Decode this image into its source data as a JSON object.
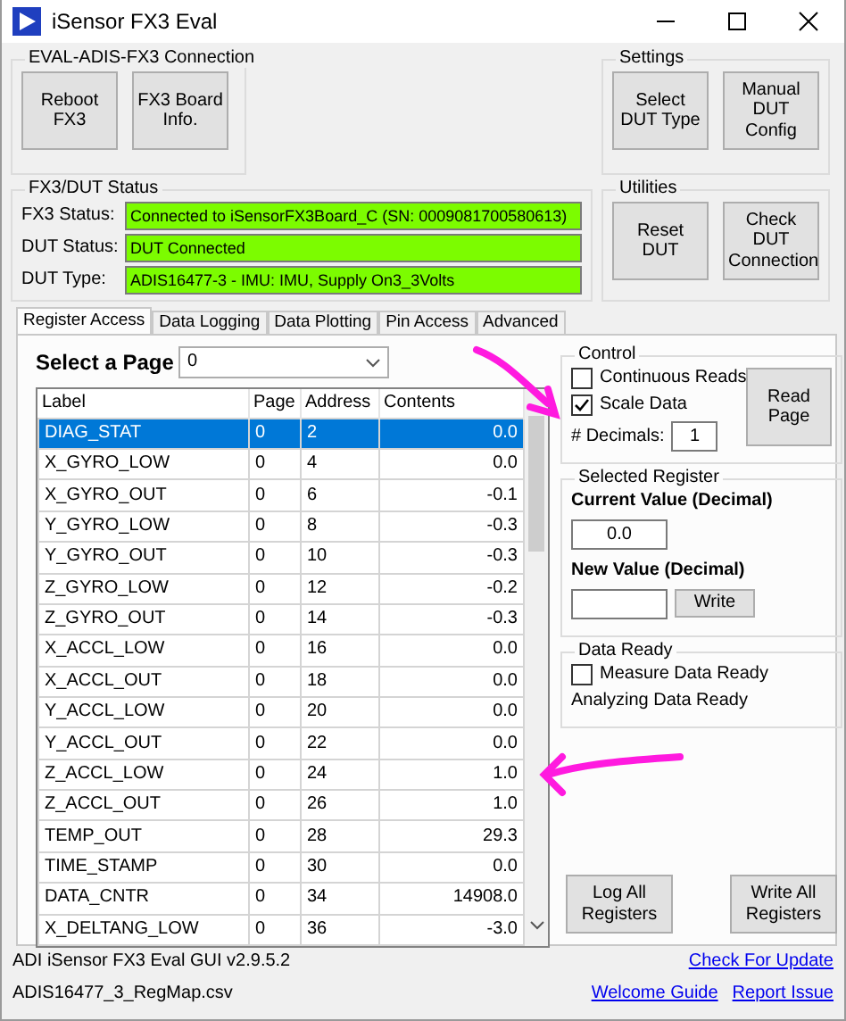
{
  "window": {
    "title": "iSensor FX3 Eval"
  },
  "connection": {
    "title": "EVAL-ADIS-FX3 Connection",
    "buttons": [
      "Reboot FX3",
      "FX3 Board Info."
    ]
  },
  "settings": {
    "title": "Settings",
    "buttons": [
      "Select DUT Type",
      "Manual DUT Config"
    ]
  },
  "status": {
    "title": "FX3/DUT Status",
    "fields": [
      {
        "label": "FX3 Status:",
        "value": "Connected to iSensorFX3Board_C (SN: 0009081700580613)"
      },
      {
        "label": "DUT Status:",
        "value": "DUT Connected"
      },
      {
        "label": "DUT Type:",
        "value": "ADIS16477-3 - IMU: IMU, Supply On3_3Volts"
      }
    ]
  },
  "utilities": {
    "title": "Utilities",
    "buttons": [
      "Reset DUT",
      "Check DUT Connection"
    ]
  },
  "tabs": [
    {
      "label": "Register Access",
      "selected": true
    },
    {
      "label": "Data Logging",
      "selected": false
    },
    {
      "label": "Data Plotting",
      "selected": false
    },
    {
      "label": "Pin Access",
      "selected": false
    },
    {
      "label": "Advanced",
      "selected": false
    }
  ],
  "page_select": {
    "label": "Select a Page",
    "value": "0"
  },
  "table": {
    "columns": [
      "Label",
      "Page",
      "Address",
      "Contents"
    ],
    "rows": [
      {
        "cells": [
          "DIAG_STAT",
          "0",
          "2",
          "0.0"
        ],
        "selected": true
      },
      {
        "cells": [
          "X_GYRO_LOW",
          "0",
          "4",
          "0.0"
        ],
        "selected": false
      },
      {
        "cells": [
          "X_GYRO_OUT",
          "0",
          "6",
          "-0.1"
        ],
        "selected": false
      },
      {
        "cells": [
          "Y_GYRO_LOW",
          "0",
          "8",
          "-0.3"
        ],
        "selected": false
      },
      {
        "cells": [
          "Y_GYRO_OUT",
          "0",
          "10",
          "-0.3"
        ],
        "selected": false
      },
      {
        "cells": [
          "Z_GYRO_LOW",
          "0",
          "12",
          "-0.2"
        ],
        "selected": false
      },
      {
        "cells": [
          "Z_GYRO_OUT",
          "0",
          "14",
          "-0.3"
        ],
        "selected": false
      },
      {
        "cells": [
          "X_ACCL_LOW",
          "0",
          "16",
          "0.0"
        ],
        "selected": false
      },
      {
        "cells": [
          "X_ACCL_OUT",
          "0",
          "18",
          "0.0"
        ],
        "selected": false
      },
      {
        "cells": [
          "Y_ACCL_LOW",
          "0",
          "20",
          "0.0"
        ],
        "selected": false
      },
      {
        "cells": [
          "Y_ACCL_OUT",
          "0",
          "22",
          "0.0"
        ],
        "selected": false
      },
      {
        "cells": [
          "Z_ACCL_LOW",
          "0",
          "24",
          "1.0"
        ],
        "selected": false
      },
      {
        "cells": [
          "Z_ACCL_OUT",
          "0",
          "26",
          "1.0"
        ],
        "selected": false
      },
      {
        "cells": [
          "TEMP_OUT",
          "0",
          "28",
          "29.3"
        ],
        "selected": false
      },
      {
        "cells": [
          "TIME_STAMP",
          "0",
          "30",
          "0.0"
        ],
        "selected": false
      },
      {
        "cells": [
          "DATA_CNTR",
          "0",
          "34",
          "14908.0"
        ],
        "selected": false
      },
      {
        "cells": [
          "X_DELTANG_LOW",
          "0",
          "36",
          "-3.0"
        ],
        "selected": false
      }
    ]
  },
  "control": {
    "title": "Control",
    "checkboxes": [
      {
        "label": "Continuous Reads",
        "checked": false
      },
      {
        "label": "Scale Data",
        "checked": true
      }
    ],
    "decimals_label": "# Decimals:",
    "decimals_value": "1",
    "read_button": "Read Page"
  },
  "selected_register": {
    "title": "Selected Register",
    "current_label": "Current Value (Decimal)",
    "current_value": "0.0",
    "new_label": "New Value (Decimal)",
    "write_button": "Write"
  },
  "data_ready": {
    "title": "Data Ready",
    "checkbox": {
      "label": "Measure Data Ready",
      "checked": false
    },
    "status_text": "Analyzing Data Ready"
  },
  "bottom_buttons": [
    "Log All Registers",
    "Write All Registers"
  ],
  "footer": {
    "version": "ADI iSensor FX3 Eval GUI v2.9.5.2",
    "file": "ADIS16477_3_RegMap.csv",
    "links": [
      "Check For Update",
      "Welcome Guide",
      "Report Issue"
    ]
  }
}
